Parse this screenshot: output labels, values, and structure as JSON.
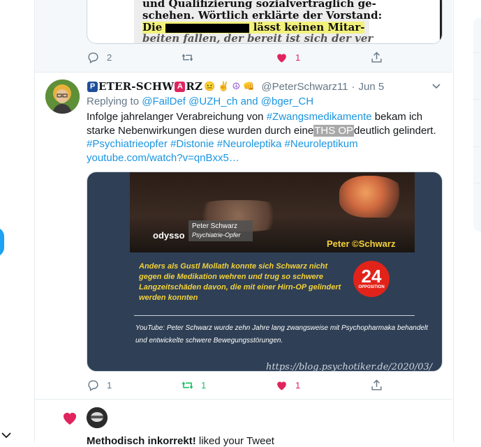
{
  "tweet_top": {
    "clipping_lines": [
      "und Qualifizierung sozialverträglich ge-",
      "schehen. Wörtlich erklärte der Vorstand:",
      "Die",
      "lässt keinen Mitar-",
      "beiten fallen, der bereit ist sich der ver"
    ],
    "reply_count": "2",
    "retweet_count": "",
    "like_count": "1"
  },
  "tweet": {
    "display_name": "ETER-SCHW",
    "name_badge_p": "P",
    "name_badge_a": "A",
    "name_end": "RZ",
    "handle": "@PeterSchwarz11",
    "date": "Jun 5",
    "replying_prefix": "Replying to",
    "replying_user1": "@FailDef",
    "replying_user2": "@UZH_ch",
    "replying_and": "and",
    "replying_user3": "@bger_CH",
    "text_part1": "Infolge jahrelanger Verabreichung von",
    "text_hashtag1": "#Zwangsmedikamente",
    "text_part2": "bekam ich starke Nebenwirkungen diese wurden durch eine",
    "text_highlight": "THS OP",
    "text_part3": "deutlich gelindert.",
    "hashtags": [
      "#Psychiatrieopfer",
      "#Distonie",
      "#Neuroleptika",
      "#Neuroleptikum"
    ],
    "link_text": "youtube.com/watch?v=qnBxx5…",
    "media": {
      "brand": "odysso",
      "lower_third_name": "Peter Schwarz",
      "lower_third_sub": "Psychiatrie-Opfer",
      "watermark": "Peter ©Schwarz",
      "quote": "Anders als Gustl Mollath konnte sich Schwarz nicht gegen die Medikation wehren und trug so schwere Langzeitschäden davon, die mit einer Hirn-OP gelindert werden konnten",
      "logo_number": "24",
      "logo_sub": "OPPOSITION",
      "caption": "YouTube: Peter Schwarz wurde zehn Jahre lang zwangsweise mit Psychopharmaka behandelt und entwickelte schwere Bewegungsstörungen.",
      "url": "https://blog.psychotiker.de/2020/03/"
    },
    "reply_count": "1",
    "retweet_count": "1",
    "like_count": "1"
  },
  "notification": {
    "user": "Methodisch inkorrekt!",
    "action": "liked your Tweet"
  },
  "colors": {
    "link": "#1b95e0",
    "like": "#e0245e",
    "retweet": "#17bf63",
    "muted": "#657786"
  }
}
